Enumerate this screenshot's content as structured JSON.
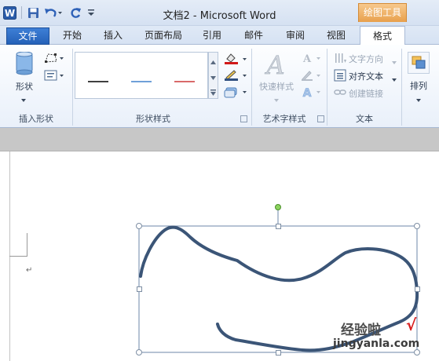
{
  "window": {
    "title": "文档2 - Microsoft Word",
    "context_tab": "绘图工具"
  },
  "tabs": [
    {
      "label": "文件"
    },
    {
      "label": "开始"
    },
    {
      "label": "插入"
    },
    {
      "label": "页面布局"
    },
    {
      "label": "引用"
    },
    {
      "label": "邮件"
    },
    {
      "label": "审阅"
    },
    {
      "label": "视图"
    },
    {
      "label": "格式"
    }
  ],
  "ribbon": {
    "insert_shapes": {
      "shapes_label": "形状",
      "group_label": "插入形状"
    },
    "shape_styles": {
      "group_label": "形状样式",
      "line_colors": [
        "#3f3f3f",
        "#6fa0d8",
        "#d96a6a"
      ]
    },
    "wordart": {
      "quick_styles_label": "快速样式",
      "group_label": "艺术字样式"
    },
    "text": {
      "direction_label": "文字方向",
      "align_label": "对齐文本",
      "link_label": "创建链接",
      "group_label": "文本"
    },
    "arrange": {
      "label": "排列"
    }
  },
  "document": {
    "paragraph_mark": "↵",
    "shape_color": "#3b5577"
  },
  "watermark": {
    "brand": "经验啦",
    "check": "√",
    "url": "jingyanla.com"
  }
}
